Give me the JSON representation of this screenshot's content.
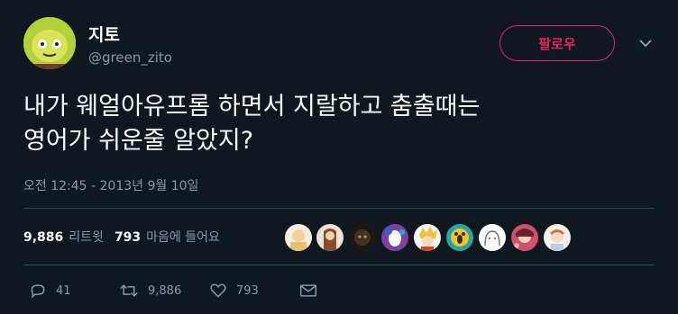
{
  "user": {
    "display_name": "지토",
    "handle": "@green_zito"
  },
  "follow_label": "팔로우",
  "tweet": {
    "text_line1": "내가 웨얼아유프롬 하면서 지랄하고 춤출때는",
    "text_line2": "영어가 쉬운줄 알았지?",
    "timestamp": "오전 12:45 - 2013년 9월 10일"
  },
  "stats": {
    "retweets": "9,886",
    "retweets_label": "리트윗",
    "likes": "793",
    "likes_label": "마음에 들어요"
  },
  "actions": {
    "replies": "41",
    "retweets": "9,886",
    "likes": "793"
  },
  "colors": {
    "background": "#10171e",
    "accent": "#e0245e",
    "muted": "#8899a6",
    "divider": "#38444d"
  }
}
